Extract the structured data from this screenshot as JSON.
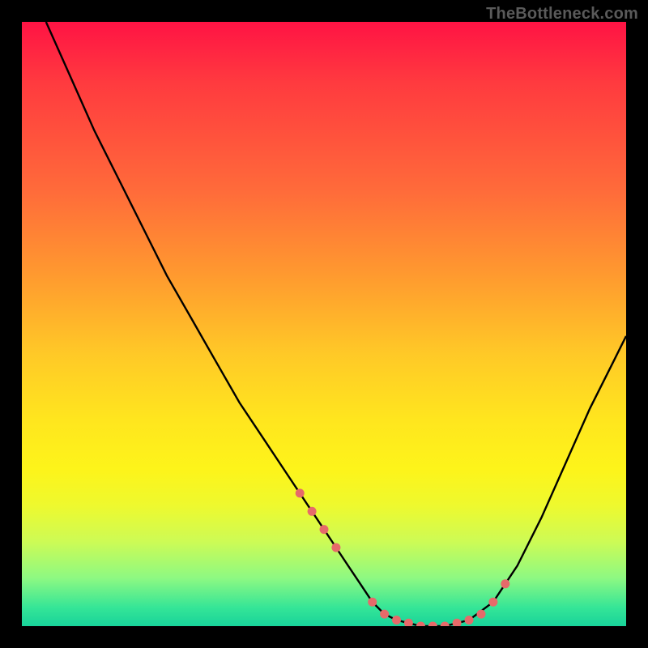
{
  "watermark": "TheBottleneck.com",
  "colors": {
    "background": "#000000",
    "gradient_top": "#ff1344",
    "gradient_mid1": "#ff9a2f",
    "gradient_mid2": "#ffe61e",
    "gradient_bottom": "#18d39a",
    "curve_stroke": "#000000",
    "marker_fill": "#e66a6a"
  },
  "chart_data": {
    "type": "line",
    "title": "",
    "xlabel": "",
    "ylabel": "",
    "xlim": [
      0,
      100
    ],
    "ylim": [
      0,
      100
    ],
    "x": [
      4,
      8,
      12,
      16,
      20,
      24,
      28,
      32,
      36,
      40,
      44,
      48,
      50,
      52,
      54,
      56,
      58,
      60,
      62,
      66,
      70,
      74,
      78,
      82,
      86,
      90,
      94,
      98,
      100
    ],
    "values": [
      100,
      91,
      82,
      74,
      66,
      58,
      51,
      44,
      37,
      31,
      25,
      19,
      16,
      13,
      10,
      7,
      4,
      2,
      1,
      0,
      0,
      1,
      4,
      10,
      18,
      27,
      36,
      44,
      48
    ],
    "markers_x": [
      46,
      48,
      50,
      52,
      58,
      60,
      62,
      64,
      66,
      68,
      70,
      72,
      74,
      76,
      78,
      80
    ],
    "markers_y": [
      22,
      19,
      16,
      13,
      4,
      2,
      1,
      0.5,
      0,
      0,
      0,
      0.5,
      1,
      2,
      4,
      7
    ]
  }
}
